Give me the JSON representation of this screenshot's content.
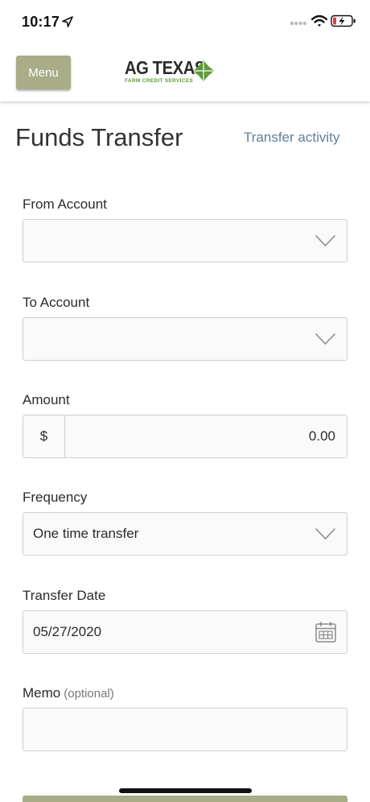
{
  "status_bar": {
    "time": "10:17"
  },
  "header": {
    "menu_label": "Menu",
    "logo_text": "AG TEXAS",
    "logo_subtext": "FARM CREDIT SERVICES",
    "brand_green": "#5e9a3a",
    "menu_color": "#a8ac87"
  },
  "page": {
    "title": "Funds Transfer",
    "activity_link": "Transfer activity"
  },
  "form": {
    "from_account": {
      "label": "From Account",
      "value": ""
    },
    "to_account": {
      "label": "To Account",
      "value": ""
    },
    "amount": {
      "label": "Amount",
      "currency": "$",
      "value": "0.00"
    },
    "frequency": {
      "label": "Frequency",
      "value": "One time transfer"
    },
    "transfer_date": {
      "label": "Transfer Date",
      "value": "05/27/2020"
    },
    "memo": {
      "label": "Memo",
      "optional": "(optional)",
      "value": ""
    }
  },
  "icons": {
    "location": "location-arrow-icon",
    "signal": "cellular-signal-icon",
    "wifi": "wifi-icon",
    "battery": "battery-charging-icon",
    "chevron": "chevron-down-icon",
    "calendar": "calendar-icon"
  }
}
